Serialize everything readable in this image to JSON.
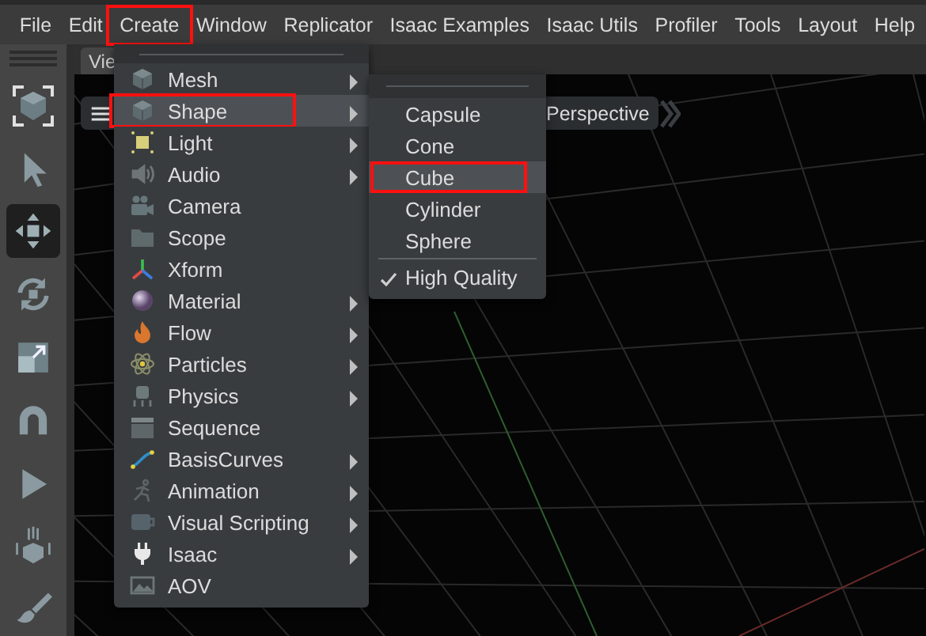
{
  "menubar": [
    {
      "label": "File",
      "highlighted": false
    },
    {
      "label": "Edit",
      "highlighted": false
    },
    {
      "label": "Create",
      "highlighted": true
    },
    {
      "label": "Window",
      "highlighted": false
    },
    {
      "label": "Replicator",
      "highlighted": false
    },
    {
      "label": "Isaac Examples",
      "highlighted": false
    },
    {
      "label": "Isaac Utils",
      "highlighted": false
    },
    {
      "label": "Profiler",
      "highlighted": false
    },
    {
      "label": "Tools",
      "highlighted": false
    },
    {
      "label": "Layout",
      "highlighted": false
    },
    {
      "label": "Help",
      "highlighted": false
    }
  ],
  "toolbar": [
    {
      "kind": "frame",
      "selected": false
    },
    {
      "kind": "select",
      "selected": false
    },
    {
      "kind": "move",
      "selected": true
    },
    {
      "kind": "rotate",
      "selected": false
    },
    {
      "kind": "scale",
      "selected": false
    },
    {
      "kind": "snap",
      "selected": false
    },
    {
      "kind": "play",
      "selected": false
    },
    {
      "kind": "drop",
      "selected": false
    },
    {
      "kind": "paint",
      "selected": false
    }
  ],
  "viewport": {
    "tab": "Vie",
    "camera": "Perspective"
  },
  "create_menu": [
    {
      "label": "Mesh",
      "kind": "cube",
      "submenu": true,
      "selected": false,
      "highlighted": false
    },
    {
      "label": "Shape",
      "kind": "cube",
      "submenu": true,
      "selected": true,
      "highlighted": true
    },
    {
      "label": "Light",
      "kind": "light",
      "submenu": true,
      "selected": false,
      "highlighted": false
    },
    {
      "label": "Audio",
      "kind": "audio",
      "submenu": true,
      "selected": false,
      "highlighted": false
    },
    {
      "label": "Camera",
      "kind": "camera",
      "submenu": false,
      "selected": false,
      "highlighted": false
    },
    {
      "label": "Scope",
      "kind": "folder",
      "submenu": false,
      "selected": false,
      "highlighted": false
    },
    {
      "label": "Xform",
      "kind": "axes",
      "submenu": false,
      "selected": false,
      "highlighted": false
    },
    {
      "label": "Material",
      "kind": "sphere",
      "submenu": true,
      "selected": false,
      "highlighted": false
    },
    {
      "label": "Flow",
      "kind": "flame",
      "submenu": true,
      "selected": false,
      "highlighted": false
    },
    {
      "label": "Particles",
      "kind": "atom",
      "submenu": true,
      "selected": false,
      "highlighted": false
    },
    {
      "label": "Physics",
      "kind": "physics",
      "submenu": true,
      "selected": false,
      "highlighted": false
    },
    {
      "label": "Sequence",
      "kind": "clapper",
      "submenu": false,
      "selected": false,
      "highlighted": false
    },
    {
      "label": "BasisCurves",
      "kind": "curve",
      "submenu": true,
      "selected": false,
      "highlighted": false
    },
    {
      "label": "Animation",
      "kind": "runner",
      "submenu": true,
      "selected": false,
      "highlighted": false
    },
    {
      "label": "Visual Scripting",
      "kind": "graph",
      "submenu": true,
      "selected": false,
      "highlighted": false
    },
    {
      "label": "Isaac",
      "kind": "plug",
      "submenu": true,
      "selected": false,
      "highlighted": false
    },
    {
      "label": "AOV",
      "kind": "image",
      "submenu": false,
      "selected": false,
      "highlighted": false
    }
  ],
  "shape_menu": [
    {
      "kind": "item",
      "label": "Capsule",
      "selected": false,
      "highlighted": false
    },
    {
      "kind": "item",
      "label": "Cone",
      "selected": false,
      "highlighted": false
    },
    {
      "kind": "item",
      "label": "Cube",
      "selected": true,
      "highlighted": true
    },
    {
      "kind": "item",
      "label": "Cylinder",
      "selected": false,
      "highlighted": false
    },
    {
      "kind": "item",
      "label": "Sphere",
      "selected": false,
      "highlighted": false
    },
    {
      "kind": "check",
      "label": "High Quality",
      "checked": true,
      "selected": false,
      "highlighted": false
    }
  ]
}
